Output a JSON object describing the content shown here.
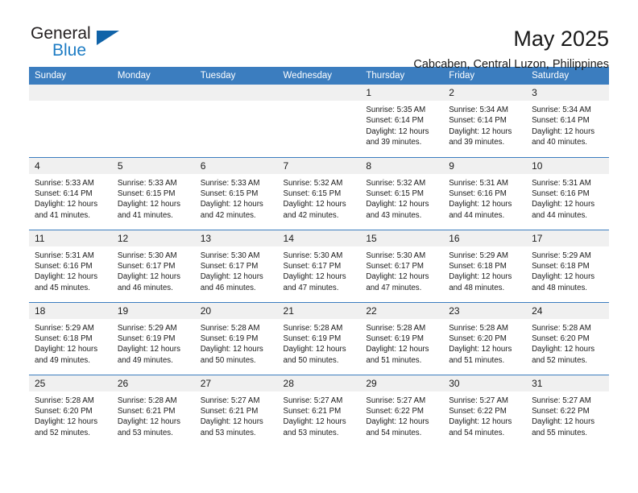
{
  "logo": {
    "word_top": "General",
    "word_bottom": "Blue",
    "triangle_color": "#1063a8",
    "blue_color": "#1d7cc4"
  },
  "header": {
    "title": "May 2025",
    "subtitle": "Cabcaben, Central Luzon, Philippines"
  },
  "theme": {
    "header_blue": "#3b7dbf",
    "daynum_bg": "#f0f0f0",
    "text": "#1a1a1a"
  },
  "weekday_headers": [
    "Sunday",
    "Monday",
    "Tuesday",
    "Wednesday",
    "Thursday",
    "Friday",
    "Saturday"
  ],
  "labels": {
    "sunrise": "Sunrise:",
    "sunset": "Sunset:",
    "daylight": "Daylight:"
  },
  "weeks": [
    [
      {
        "day": "",
        "empty": true
      },
      {
        "day": "",
        "empty": true
      },
      {
        "day": "",
        "empty": true
      },
      {
        "day": "",
        "empty": true
      },
      {
        "day": "1",
        "sunrise": "Sunrise: 5:35 AM",
        "sunset": "Sunset: 6:14 PM",
        "daylight_1": "Daylight: 12 hours",
        "daylight_2": "and 39 minutes."
      },
      {
        "day": "2",
        "sunrise": "Sunrise: 5:34 AM",
        "sunset": "Sunset: 6:14 PM",
        "daylight_1": "Daylight: 12 hours",
        "daylight_2": "and 39 minutes."
      },
      {
        "day": "3",
        "sunrise": "Sunrise: 5:34 AM",
        "sunset": "Sunset: 6:14 PM",
        "daylight_1": "Daylight: 12 hours",
        "daylight_2": "and 40 minutes."
      }
    ],
    [
      {
        "day": "4",
        "sunrise": "Sunrise: 5:33 AM",
        "sunset": "Sunset: 6:14 PM",
        "daylight_1": "Daylight: 12 hours",
        "daylight_2": "and 41 minutes."
      },
      {
        "day": "5",
        "sunrise": "Sunrise: 5:33 AM",
        "sunset": "Sunset: 6:15 PM",
        "daylight_1": "Daylight: 12 hours",
        "daylight_2": "and 41 minutes."
      },
      {
        "day": "6",
        "sunrise": "Sunrise: 5:33 AM",
        "sunset": "Sunset: 6:15 PM",
        "daylight_1": "Daylight: 12 hours",
        "daylight_2": "and 42 minutes."
      },
      {
        "day": "7",
        "sunrise": "Sunrise: 5:32 AM",
        "sunset": "Sunset: 6:15 PM",
        "daylight_1": "Daylight: 12 hours",
        "daylight_2": "and 42 minutes."
      },
      {
        "day": "8",
        "sunrise": "Sunrise: 5:32 AM",
        "sunset": "Sunset: 6:15 PM",
        "daylight_1": "Daylight: 12 hours",
        "daylight_2": "and 43 minutes."
      },
      {
        "day": "9",
        "sunrise": "Sunrise: 5:31 AM",
        "sunset": "Sunset: 6:16 PM",
        "daylight_1": "Daylight: 12 hours",
        "daylight_2": "and 44 minutes."
      },
      {
        "day": "10",
        "sunrise": "Sunrise: 5:31 AM",
        "sunset": "Sunset: 6:16 PM",
        "daylight_1": "Daylight: 12 hours",
        "daylight_2": "and 44 minutes."
      }
    ],
    [
      {
        "day": "11",
        "sunrise": "Sunrise: 5:31 AM",
        "sunset": "Sunset: 6:16 PM",
        "daylight_1": "Daylight: 12 hours",
        "daylight_2": "and 45 minutes."
      },
      {
        "day": "12",
        "sunrise": "Sunrise: 5:30 AM",
        "sunset": "Sunset: 6:17 PM",
        "daylight_1": "Daylight: 12 hours",
        "daylight_2": "and 46 minutes."
      },
      {
        "day": "13",
        "sunrise": "Sunrise: 5:30 AM",
        "sunset": "Sunset: 6:17 PM",
        "daylight_1": "Daylight: 12 hours",
        "daylight_2": "and 46 minutes."
      },
      {
        "day": "14",
        "sunrise": "Sunrise: 5:30 AM",
        "sunset": "Sunset: 6:17 PM",
        "daylight_1": "Daylight: 12 hours",
        "daylight_2": "and 47 minutes."
      },
      {
        "day": "15",
        "sunrise": "Sunrise: 5:30 AM",
        "sunset": "Sunset: 6:17 PM",
        "daylight_1": "Daylight: 12 hours",
        "daylight_2": "and 47 minutes."
      },
      {
        "day": "16",
        "sunrise": "Sunrise: 5:29 AM",
        "sunset": "Sunset: 6:18 PM",
        "daylight_1": "Daylight: 12 hours",
        "daylight_2": "and 48 minutes."
      },
      {
        "day": "17",
        "sunrise": "Sunrise: 5:29 AM",
        "sunset": "Sunset: 6:18 PM",
        "daylight_1": "Daylight: 12 hours",
        "daylight_2": "and 48 minutes."
      }
    ],
    [
      {
        "day": "18",
        "sunrise": "Sunrise: 5:29 AM",
        "sunset": "Sunset: 6:18 PM",
        "daylight_1": "Daylight: 12 hours",
        "daylight_2": "and 49 minutes."
      },
      {
        "day": "19",
        "sunrise": "Sunrise: 5:29 AM",
        "sunset": "Sunset: 6:19 PM",
        "daylight_1": "Daylight: 12 hours",
        "daylight_2": "and 49 minutes."
      },
      {
        "day": "20",
        "sunrise": "Sunrise: 5:28 AM",
        "sunset": "Sunset: 6:19 PM",
        "daylight_1": "Daylight: 12 hours",
        "daylight_2": "and 50 minutes."
      },
      {
        "day": "21",
        "sunrise": "Sunrise: 5:28 AM",
        "sunset": "Sunset: 6:19 PM",
        "daylight_1": "Daylight: 12 hours",
        "daylight_2": "and 50 minutes."
      },
      {
        "day": "22",
        "sunrise": "Sunrise: 5:28 AM",
        "sunset": "Sunset: 6:19 PM",
        "daylight_1": "Daylight: 12 hours",
        "daylight_2": "and 51 minutes."
      },
      {
        "day": "23",
        "sunrise": "Sunrise: 5:28 AM",
        "sunset": "Sunset: 6:20 PM",
        "daylight_1": "Daylight: 12 hours",
        "daylight_2": "and 51 minutes."
      },
      {
        "day": "24",
        "sunrise": "Sunrise: 5:28 AM",
        "sunset": "Sunset: 6:20 PM",
        "daylight_1": "Daylight: 12 hours",
        "daylight_2": "and 52 minutes."
      }
    ],
    [
      {
        "day": "25",
        "sunrise": "Sunrise: 5:28 AM",
        "sunset": "Sunset: 6:20 PM",
        "daylight_1": "Daylight: 12 hours",
        "daylight_2": "and 52 minutes."
      },
      {
        "day": "26",
        "sunrise": "Sunrise: 5:28 AM",
        "sunset": "Sunset: 6:21 PM",
        "daylight_1": "Daylight: 12 hours",
        "daylight_2": "and 53 minutes."
      },
      {
        "day": "27",
        "sunrise": "Sunrise: 5:27 AM",
        "sunset": "Sunset: 6:21 PM",
        "daylight_1": "Daylight: 12 hours",
        "daylight_2": "and 53 minutes."
      },
      {
        "day": "28",
        "sunrise": "Sunrise: 5:27 AM",
        "sunset": "Sunset: 6:21 PM",
        "daylight_1": "Daylight: 12 hours",
        "daylight_2": "and 53 minutes."
      },
      {
        "day": "29",
        "sunrise": "Sunrise: 5:27 AM",
        "sunset": "Sunset: 6:22 PM",
        "daylight_1": "Daylight: 12 hours",
        "daylight_2": "and 54 minutes."
      },
      {
        "day": "30",
        "sunrise": "Sunrise: 5:27 AM",
        "sunset": "Sunset: 6:22 PM",
        "daylight_1": "Daylight: 12 hours",
        "daylight_2": "and 54 minutes."
      },
      {
        "day": "31",
        "sunrise": "Sunrise: 5:27 AM",
        "sunset": "Sunset: 6:22 PM",
        "daylight_1": "Daylight: 12 hours",
        "daylight_2": "and 55 minutes."
      }
    ]
  ]
}
